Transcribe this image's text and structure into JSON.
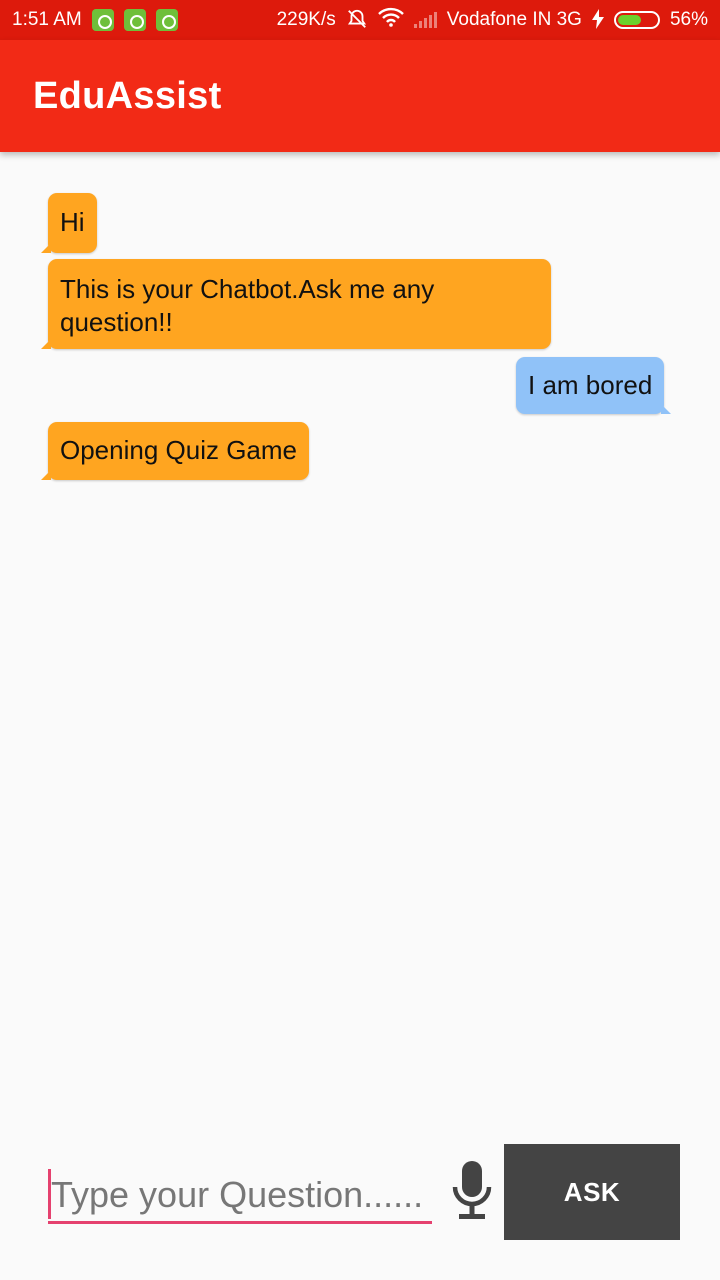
{
  "status_bar": {
    "time": "1:51 AM",
    "speed": "229K/s",
    "carrier": "Vodafone IN 3G",
    "battery": "56%",
    "battery_level": 0.56,
    "icons": [
      "app-icon",
      "battery-app-icon",
      "app-icon",
      "mute-bell-icon",
      "wifi-icon",
      "signal-icon",
      "charging-icon",
      "battery-icon"
    ]
  },
  "app_bar": {
    "title": "EduAssist",
    "color": "#f22a16"
  },
  "chat": {
    "messages": [
      {
        "sender": "bot",
        "text": "Hi"
      },
      {
        "sender": "bot",
        "text": "This is your Chatbot.Ask me any question!!"
      },
      {
        "sender": "user",
        "text": "I am bored"
      },
      {
        "sender": "bot",
        "text": "Opening Quiz Game"
      }
    ],
    "bot_color": "#ffa520",
    "user_color": "#90c2f8"
  },
  "input": {
    "value": "",
    "placeholder": "Type your Question......",
    "mic_icon": "microphone-icon",
    "ask_label": "ASK"
  }
}
